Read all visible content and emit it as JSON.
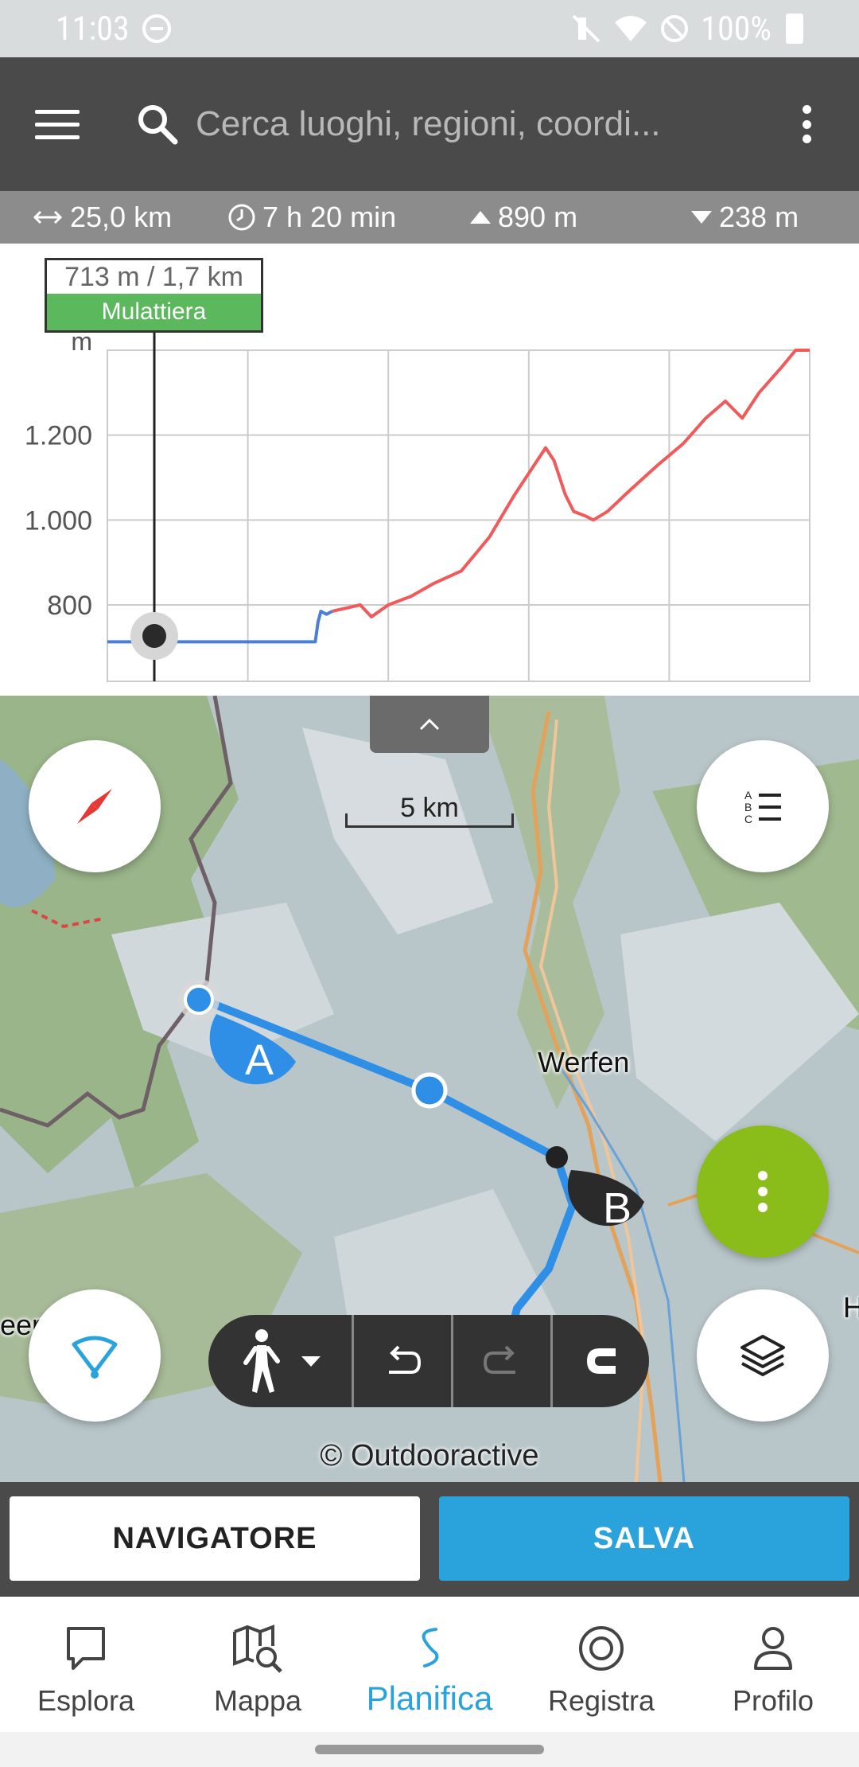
{
  "status_bar": {
    "time": "11:03",
    "battery": "100%",
    "icons": [
      "dnd-icon",
      "mute-icon",
      "wifi-icon",
      "block-icon",
      "battery-icon"
    ]
  },
  "search": {
    "placeholder": "Cerca luoghi, regioni, coordi..."
  },
  "stats": {
    "distance": "25,0 km",
    "duration": "7 h 20 min",
    "ascent": "890 m",
    "descent": "238 m"
  },
  "profile": {
    "marker_value": "713 m / 1,7 km",
    "surface": "Mulattiera",
    "surface_color": "#5cb85c"
  },
  "chart_data": {
    "type": "line",
    "ylabel": "m",
    "yticks": [
      "800",
      "1.000",
      "1.200"
    ],
    "ylim": [
      620,
      1400
    ],
    "xlim": [
      0,
      25
    ],
    "grid": true,
    "series": [
      {
        "color": "#4a7fd4",
        "points": [
          [
            0,
            713
          ],
          [
            7.4,
            713
          ],
          [
            7.5,
            760
          ],
          [
            7.6,
            785
          ],
          [
            7.8,
            778
          ],
          [
            8.0,
            785
          ]
        ]
      },
      {
        "color": "#f05a5a",
        "points": [
          [
            8.0,
            785
          ],
          [
            9.0,
            800
          ],
          [
            9.4,
            772
          ],
          [
            10.0,
            800
          ],
          [
            10.8,
            820
          ],
          [
            11.6,
            850
          ],
          [
            12.6,
            880
          ],
          [
            13.6,
            960
          ],
          [
            14.5,
            1060
          ],
          [
            15.2,
            1130
          ],
          [
            15.6,
            1170
          ],
          [
            15.9,
            1140
          ],
          [
            16.3,
            1060
          ],
          [
            16.6,
            1020
          ],
          [
            17.0,
            1010
          ],
          [
            17.3,
            1000
          ],
          [
            17.8,
            1020
          ],
          [
            18.6,
            1070
          ],
          [
            19.6,
            1130
          ],
          [
            20.5,
            1180
          ],
          [
            21.3,
            1240
          ],
          [
            22.0,
            1280
          ],
          [
            22.6,
            1240
          ],
          [
            23.2,
            1300
          ],
          [
            24.0,
            1360
          ],
          [
            24.5,
            1400
          ],
          [
            25.0,
            1400
          ]
        ]
      }
    ]
  },
  "map": {
    "scale_label": "5 km",
    "place_werfen": "Werfen",
    "place_left": "eer",
    "place_right": "H",
    "marker_a": "A",
    "marker_b": "B",
    "copyright": "© Outdooractive",
    "route_color": "#2f8fe6",
    "toolbar": [
      "walk-icon",
      "undo-icon",
      "redo-icon",
      "magnet-icon"
    ]
  },
  "actions": {
    "navigator": "NAVIGATORE",
    "save": "SALVA"
  },
  "nav": {
    "explore": "Esplora",
    "map": "Mappa",
    "plan": "Planifica",
    "record": "Registra",
    "profile": "Profilo",
    "active": "plan"
  }
}
